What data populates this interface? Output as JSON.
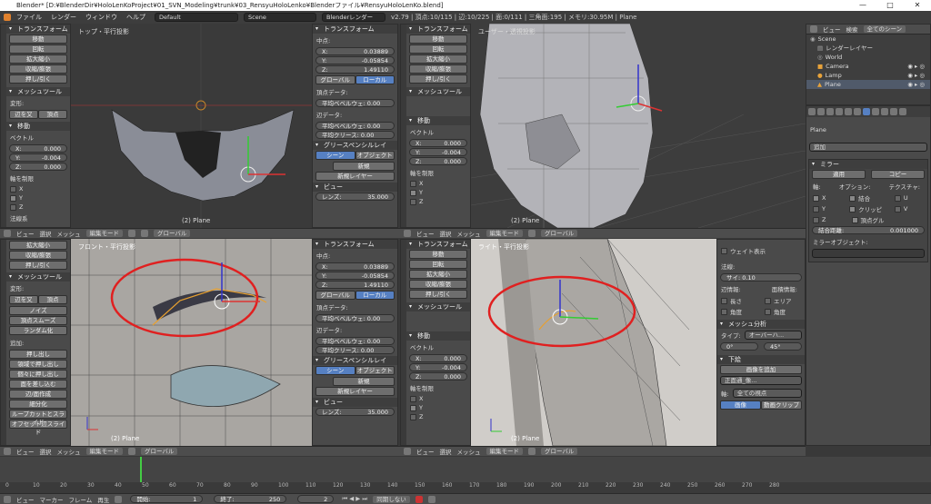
{
  "titlebar": {
    "text": "Blender* [D:¥BlenderDir¥HoloLenKoProject¥01_SVN_Modeling¥trunk¥03_RensyuHoloLenko¥Blenderファイル¥RensyuHoloLenKo.blend]",
    "min": "—",
    "max": "□",
    "close": "✕"
  },
  "infobar": {
    "menus": [
      "ファイル",
      "レンダー",
      "ウィンドウ",
      "ヘルプ"
    ],
    "layout": "Default",
    "scene": "Scene",
    "engine": "Blenderレンダー",
    "stats": "v2.79 | 頂点:10/115 | 辺:10/225 | 面:0/111 | 三角面:195 | メモリ:30.95M | Plane"
  },
  "tools_tl": {
    "title": "トランスフォーム",
    "buttons": [
      "移動",
      "回転",
      "拡大縮小",
      "収縮/膨張",
      "押し/引く"
    ],
    "mesh_title": "メッシュツール",
    "deform": "変形:",
    "deform_btns": [
      "辺を又",
      "頂点"
    ],
    "move_title": "移動",
    "vector": "ベクトル",
    "x": "X:",
    "xv": "0.000",
    "y": "Y:",
    "yv": "-0.004",
    "z": "Z:",
    "zv": "0.000",
    "axis_lock": "軸を制限",
    "ax": "X",
    "ay": "Y",
    "az": "Z",
    "last": "法線系"
  },
  "tools_bl": {
    "buttons": [
      "拡大縮小",
      "収縮/膨張",
      "押し/引く"
    ],
    "mesh_title": "メッシュツール",
    "deform": "変形:",
    "deform_btns": [
      "辺を又",
      "頂点"
    ],
    "extra": [
      "ノイズ",
      "頂点スムーズ",
      "ランダム化"
    ],
    "add": "追加:",
    "add_btns": [
      "押し出し",
      "領域で押し出し",
      "個々に押し出し",
      "面を差し込む",
      "辺/面作成",
      "細分化",
      "ループカットとスライド",
      "オフセット辺スライド"
    ]
  },
  "nprop_tr": {
    "title": "トランスフォーム",
    "median": "中点:",
    "x": "X:",
    "xv": "0.03889",
    "y": "Y:",
    "yv": "-0.05854",
    "z": "Z:",
    "zv": "1.49110",
    "global": "グローバル",
    "local": "ローカル",
    "vdata": "頂点データ:",
    "bevel_w": "平均ベベルウェ: 0.00",
    "edata": "辺データ:",
    "bevel_w2": "平均ベベルウェ: 0.00",
    "crease": "平均クリース: 0.00",
    "gp": "グリースペンシルレイ",
    "scene": "シーン",
    "object": "オブジェクト",
    "new": "新規",
    "new_layer": "新規レイヤー",
    "view": "ビュー",
    "lens": "レンズ:",
    "lensv": "35.000"
  },
  "nprop_br": {
    "title": "トランスフォーム",
    "buttons": [
      "移動",
      "回転",
      "拡大縮小",
      "収縮/膨張",
      "押し/引く"
    ],
    "mesh_title": "メッシュツール",
    "move_title": "移動",
    "vector": "ベクトル",
    "x": "X:",
    "xv": "0.000",
    "y": "Y:",
    "yv": "-0.004",
    "z": "Z:",
    "zv": "0.000",
    "axis_lock": "軸を制限",
    "ax": "X",
    "ay": "Y",
    "az": "Z"
  },
  "viewports": {
    "top": "トップ・平行投影",
    "user": "ユーザー・透視投影",
    "front": "フロント・平行投影",
    "right": "ライト・平行投影",
    "obj": "(2) Plane"
  },
  "vpheader": {
    "view": "ビュー",
    "select": "選択",
    "mesh": "メッシュ",
    "mode": "編集モード",
    "pivot": "グローバル"
  },
  "outliner": {
    "view": "ビュー",
    "search": "検索",
    "all": "全てのシーン",
    "scene": "Scene",
    "renderlayer": "レンダーレイヤー",
    "world": "World",
    "camera": "Camera",
    "lamp": "Lamp",
    "plane": "Plane"
  },
  "properties": {
    "obj": "Plane",
    "add": "追加",
    "mod": "ミラー",
    "apply": "適用",
    "copy": "コピー",
    "axis": "軸:",
    "options": "オプション:",
    "texture": "テクスチャ:",
    "x": "X",
    "y": "Y",
    "z": "Z",
    "merge": "結合",
    "clip": "クリッピ",
    "vgroup": "頂点グル",
    "u": "U",
    "v": "V",
    "merge_dist": "結合距離:",
    "merge_distv": "0.001000",
    "mirror_obj": "ミラーオブジェクト:",
    "weight": "ウェイト表示",
    "normal": "法線:",
    "size": "サイ: 0.10",
    "edge_info": "辺情報:",
    "face_info": "面積情報:",
    "length": "長さ",
    "area": "エリア",
    "angle": "角度",
    "angle2": "角度",
    "mesh_analysis": "メッシュ分析",
    "type": "タイプ:",
    "overhang": "オーバーハ...",
    "deg0": "0°",
    "deg45": "45°",
    "bg": "下絵",
    "add_image": "画像を追加",
    "camera_view": "正面通_像...",
    "axis_all": "全ての視点",
    "image": "画像",
    "movie": "動画クリップ"
  },
  "timeline": {
    "view": "ビュー",
    "marker": "マーカー",
    "frame": "フレーム",
    "play": "再生",
    "start": "開始:",
    "startv": "1",
    "end": "終了:",
    "endv": "250",
    "cur": "2",
    "sync": "同期しない",
    "ticks": [
      "0",
      "10",
      "20",
      "30",
      "40",
      "50",
      "60",
      "70",
      "80",
      "90",
      "100",
      "110",
      "120",
      "130",
      "140",
      "150",
      "160",
      "170",
      "180",
      "190",
      "200",
      "210",
      "220",
      "230",
      "240",
      "250",
      "260",
      "270",
      "280"
    ]
  }
}
